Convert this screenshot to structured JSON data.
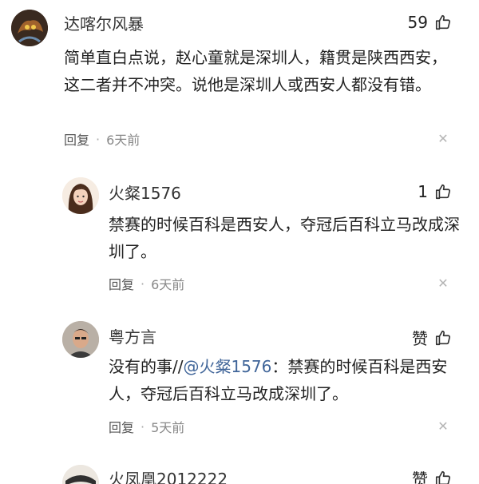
{
  "comments": [
    {
      "username": "达喀尔风暴",
      "likes": "59",
      "text": "简单直白点说，赵心童就是深圳人，籍贯是陕西西安，这二者并不冲突。说他是深圳人或西安人都没有错。",
      "reply_label": "回复",
      "time": "6天前",
      "avatar_icon": "avatar-dark-warrior"
    },
    {
      "username": "火粲1576",
      "likes": "1",
      "text": "禁赛的时候百科是西安人，夺冠后百科立马改成深圳了。",
      "reply_label": "回复",
      "time": "6天前",
      "avatar_icon": "avatar-girl"
    },
    {
      "username": "粤方言",
      "likes": "赞",
      "text_prefix": "没有的事//",
      "mention": "@火粲1576",
      "text_suffix": "：禁赛的时候百科是西安人，夺冠后百科立马改成深圳了。",
      "reply_label": "回复",
      "time": "5天前",
      "avatar_icon": "avatar-man"
    },
    {
      "username": "火凤凰2012222",
      "likes": "赞",
      "avatar_icon": "avatar-partial"
    }
  ],
  "icons": {
    "like": "thumbs-up-icon",
    "close": "close-icon"
  },
  "colors": {
    "mention": "#406599",
    "meta": "#888888"
  }
}
